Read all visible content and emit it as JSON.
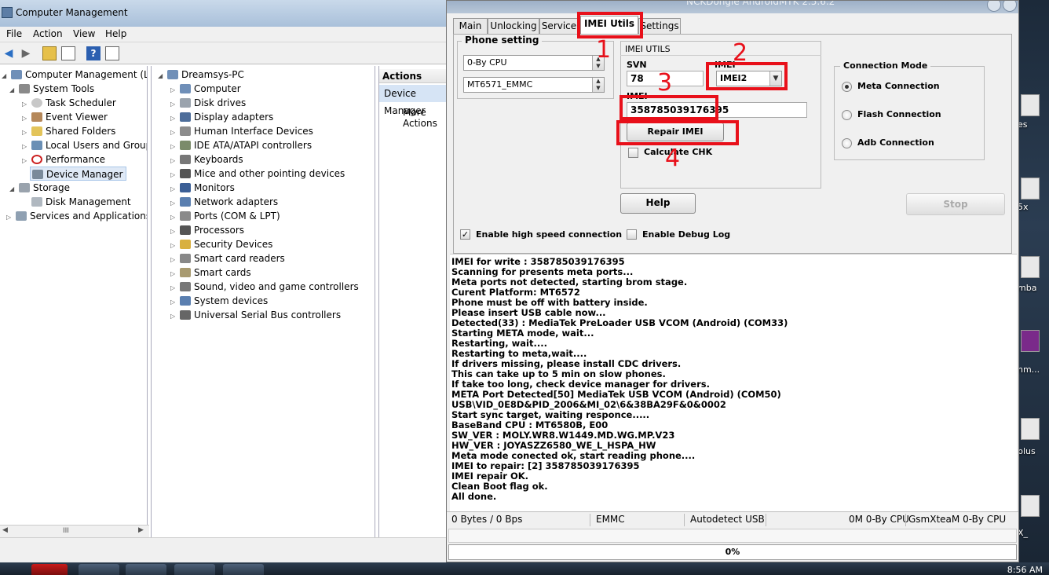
{
  "cm": {
    "title": "Computer Management",
    "menu": [
      "File",
      "Action",
      "View",
      "Help"
    ],
    "tree": {
      "root": "Computer Management (Local",
      "system_tools": "System Tools",
      "task_scheduler": "Task Scheduler",
      "event_viewer": "Event Viewer",
      "shared_folders": "Shared Folders",
      "local_users": "Local Users and Groups",
      "performance": "Performance",
      "device_manager": "Device Manager",
      "storage": "Storage",
      "disk_management": "Disk Management",
      "services": "Services and Applications"
    },
    "devices": {
      "pc": "Dreamsys-PC",
      "items": [
        "Computer",
        "Disk drives",
        "Display adapters",
        "Human Interface Devices",
        "IDE ATA/ATAPI controllers",
        "Keyboards",
        "Mice and other pointing devices",
        "Monitors",
        "Network adapters",
        "Ports (COM & LPT)",
        "Processors",
        "Security Devices",
        "Smart card readers",
        "Smart cards",
        "Sound, video and game controllers",
        "System devices",
        "Universal Serial Bus controllers"
      ]
    },
    "actions": {
      "header": "Actions",
      "selected": "Device Manager",
      "more": "More Actions"
    },
    "scroll_grip": "III"
  },
  "nck": {
    "title": "NCKDongle AndroidMTK 2.5.6.2",
    "tabs": [
      "Main",
      "Unlocking",
      "Service",
      "IMEI Utils",
      "Settings"
    ],
    "active_tab": "IMEI Utils",
    "phone_setting": {
      "title": "Phone setting",
      "cpu": "0-By CPU",
      "model": "MT6571_EMMC"
    },
    "imei_utils": {
      "title": "IMEI UTILS",
      "svn_label": "SVN",
      "svn_value": "78",
      "imei_select_label": "IMEI",
      "imei_select_value": "IMEI2",
      "imei_label": "IMEI",
      "imei_value": "358785039176395",
      "repair_button": "Repair IMEI",
      "calc_chk": "Calculate CHK"
    },
    "connection_mode": {
      "title": "Connection Mode",
      "options": [
        "Meta Connection",
        "Flash Connection",
        "Adb Connection"
      ],
      "selected": "Meta Connection"
    },
    "help_button": "Help",
    "stop_button": "Stop",
    "high_speed": "Enable high speed connection",
    "debug_log": "Enable Debug Log",
    "annotations": [
      "1",
      "2",
      "3",
      "4"
    ],
    "annotation_color": "#e8101a",
    "log": [
      "IMEI for write : 358785039176395",
      "Scanning for presents meta ports...",
      "Meta ports not detected, starting brom stage.",
      "Curent Platform: MT6572",
      "Phone must be off with battery inside.",
      "Please insert USB cable now...",
      "Detected(33) : MediaTek PreLoader USB VCOM (Android) (COM33)",
      "Starting META mode, wait...",
      "Restarting, wait....",
      "Restarting to meta,wait....",
      "If drivers missing, please install CDC drivers.",
      "This can take up to 5 min on slow phones.",
      "If take too long, check device manager for drivers.",
      "META Port Detected[50] MediaTek USB VCOM (Android) (COM50)",
      "USB\\VID_0E8D&PID_2006&MI_02\\6&38BA29F&0&0002",
      "Start sync target, waiting responce.....",
      "BaseBand CPU : MT6580B, E00",
      "SW_VER : MOLY.WR8.W1449.MD.WG.MP.V23",
      "HW_VER : JOYASZZ6580_WE_L_HSPA_HW",
      "Meta mode conected ok, start reading phone....",
      "IMEI to repair: [2] 358785039176395",
      "IMEI repair OK.",
      "Clean Boot flag ok.",
      "All done."
    ],
    "status": {
      "transfer": "0 Bytes / 0 Bps",
      "storage": "EMMC",
      "usb": "Autodetect USB",
      "cpu": "0M 0-By CPU",
      "team": "GsmXteaM 0-By CPU"
    },
    "progress": "0%"
  },
  "desktop_labels": [
    "es",
    "5x",
    "mba",
    "nm...",
    "plus",
    "X_"
  ],
  "clock": "8:56 AM"
}
